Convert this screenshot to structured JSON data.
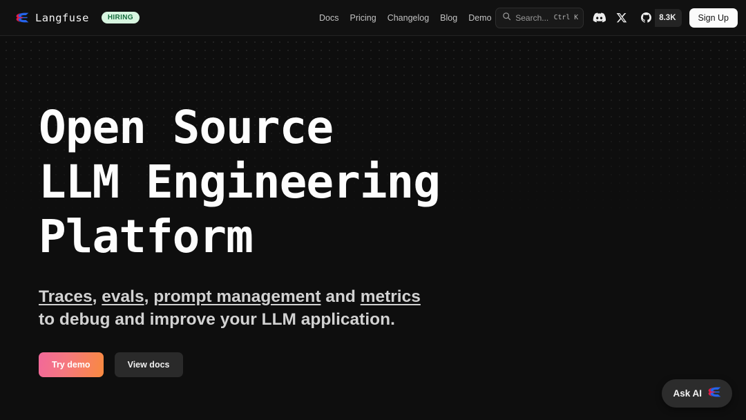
{
  "header": {
    "brand": {
      "logo_icon": "langfuse-logo-icon",
      "name": "Langfuse",
      "badge": "HIRING"
    },
    "nav": [
      {
        "label": "Docs"
      },
      {
        "label": "Pricing"
      },
      {
        "label": "Changelog"
      },
      {
        "label": "Blog"
      },
      {
        "label": "Demo"
      }
    ],
    "search": {
      "icon": "search-icon",
      "placeholder": "Search...",
      "shortcut": "Ctrl K"
    },
    "social": [
      {
        "icon": "discord-icon",
        "name": "discord"
      },
      {
        "icon": "x-twitter-icon",
        "name": "x-twitter"
      }
    ],
    "github": {
      "icon": "github-icon",
      "stars": "8.3K"
    },
    "signup_label": "Sign Up"
  },
  "hero": {
    "headline_lines": [
      "Open Source",
      "LLM Engineering",
      "Platform"
    ],
    "subhead": {
      "link1": "Traces",
      "sep1": ", ",
      "link2": "evals",
      "sep2": ", ",
      "link3": "prompt management",
      "sep3": " and ",
      "link4": "metrics",
      "line2": "to debug and improve your LLM application."
    },
    "cta": {
      "primary_label": "Try demo",
      "secondary_label": "View docs"
    }
  },
  "ask_ai": {
    "label": "Ask AI",
    "icon": "langfuse-logo-icon"
  },
  "colors": {
    "page_bg": "#0e0e0e",
    "header_bg": "#111111",
    "accent_pink": "#f2689a",
    "accent_orange": "#f98a3f",
    "badge_bg": "#d7f5e0",
    "badge_text": "#156b3d",
    "logo_red": "#e11d48",
    "logo_blue": "#2563eb"
  }
}
